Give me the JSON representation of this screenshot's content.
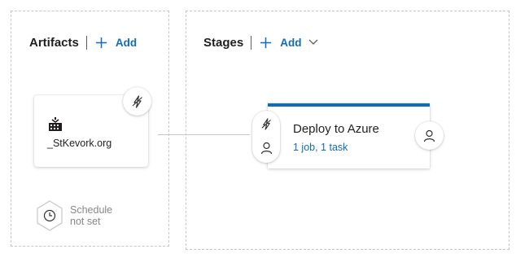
{
  "artifacts": {
    "title": "Artifacts",
    "add_label": "Add",
    "items": [
      {
        "name": "_StKevork.org",
        "icon": "build-icon"
      }
    ],
    "schedule": {
      "line1": "Schedule",
      "line2": "not set"
    }
  },
  "stages": {
    "title": "Stages",
    "add_label": "Add",
    "items": [
      {
        "name": "Deploy to Azure",
        "summary": "1 job, 1 task"
      }
    ]
  },
  "colors": {
    "accent": "#0f6cbd",
    "border": "#c8c6c4",
    "muted_text": "#8a8886"
  }
}
